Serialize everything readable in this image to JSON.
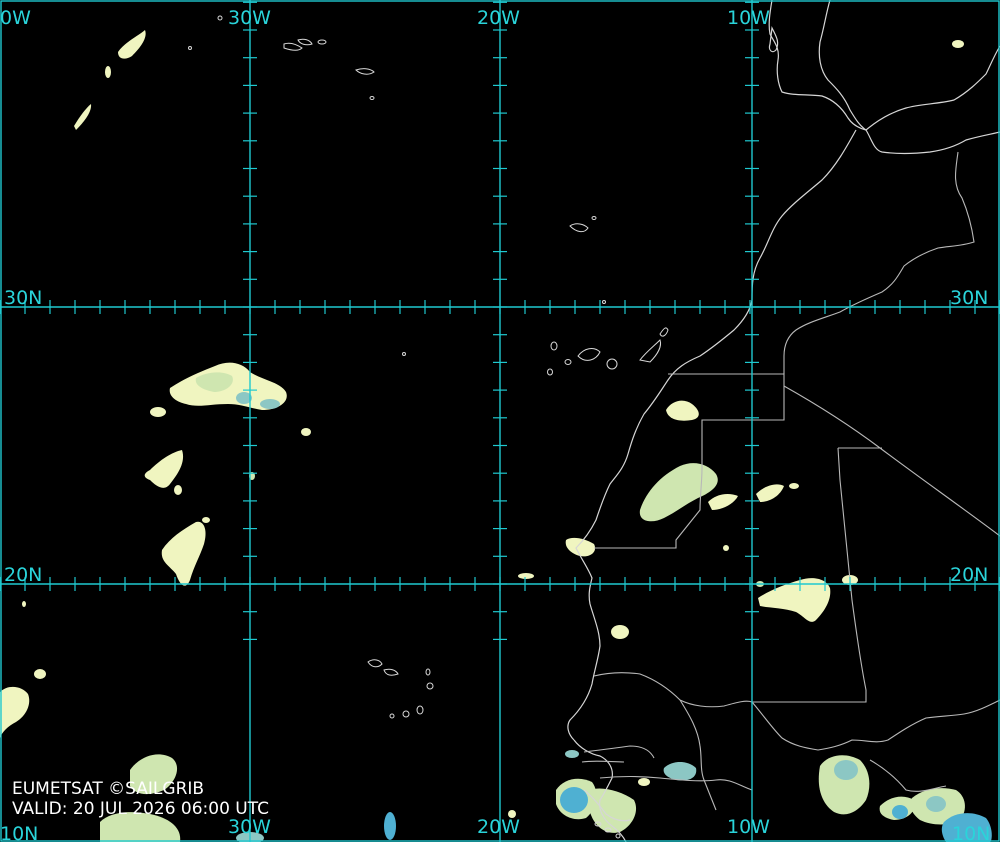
{
  "map": {
    "longitude_labels": [
      "30W",
      "20W",
      "10W"
    ],
    "latitude_labels": [
      "30N",
      "20N"
    ],
    "edge_labels": {
      "top_left_fragment": "0W",
      "bottom_left_fragment": "10N",
      "bottom_right_fragment": "10N"
    },
    "colors": {
      "background": "#000000",
      "graticule": "#1fc9cf",
      "coastline": "#d6d6d6",
      "cloud_light": "#f0f5c0",
      "cloud_mid": "#cfe6b0",
      "cloud_teal": "#8cc7c4",
      "cloud_blue": "#4fb0d2"
    }
  },
  "credit": {
    "line1": "EUMETSAT ©SAILGRIB",
    "line2": "VALID:  20 JUL 2026 06:00 UTC"
  }
}
